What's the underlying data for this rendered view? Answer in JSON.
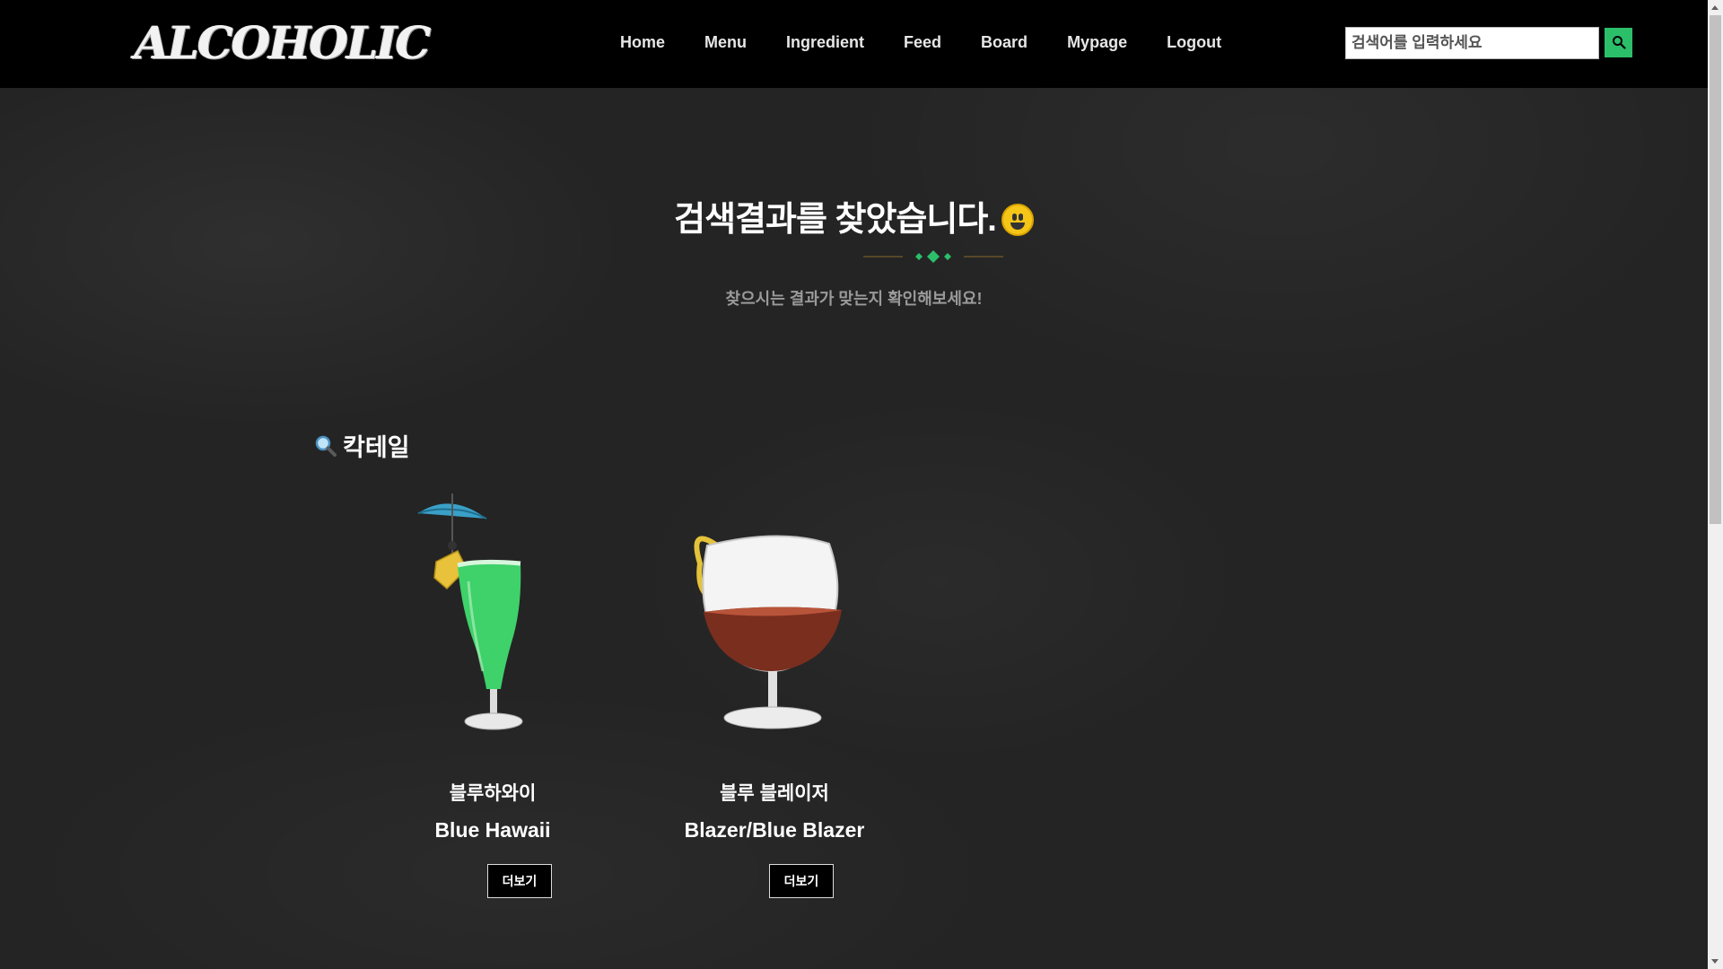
{
  "header": {
    "logo_text": "ALCOHOLIC",
    "nav": [
      {
        "label": "Home"
      },
      {
        "label": "Menu"
      },
      {
        "label": "Ingredient"
      },
      {
        "label": "Feed"
      },
      {
        "label": "Board"
      },
      {
        "label": "Mypage"
      },
      {
        "label": "Logout"
      }
    ],
    "search": {
      "placeholder": "검색어를 입력하세요",
      "value": "",
      "button_icon": "search-icon",
      "button_color": "#2bbf6a"
    }
  },
  "hero": {
    "title": "검색결과를 찾았습니다.",
    "emoji_icon": "smiley-icon",
    "subtitle": "찾으시는 결과가 맞는지 확인해보세요!",
    "accent_color": "#2bbf6a"
  },
  "section": {
    "icon": "magnifier-icon",
    "title": "칵테일"
  },
  "results": [
    {
      "name_kor": "블루하와이",
      "name_eng": "Blue Hawaii",
      "more_label": "더보기",
      "image_icon": "blue-hawaii-cocktail-image"
    },
    {
      "name_kor": "블루 블레이저",
      "name_eng": "Blazer/Blue Blazer",
      "more_label": "더보기",
      "image_icon": "blue-blazer-cocktail-image"
    }
  ]
}
